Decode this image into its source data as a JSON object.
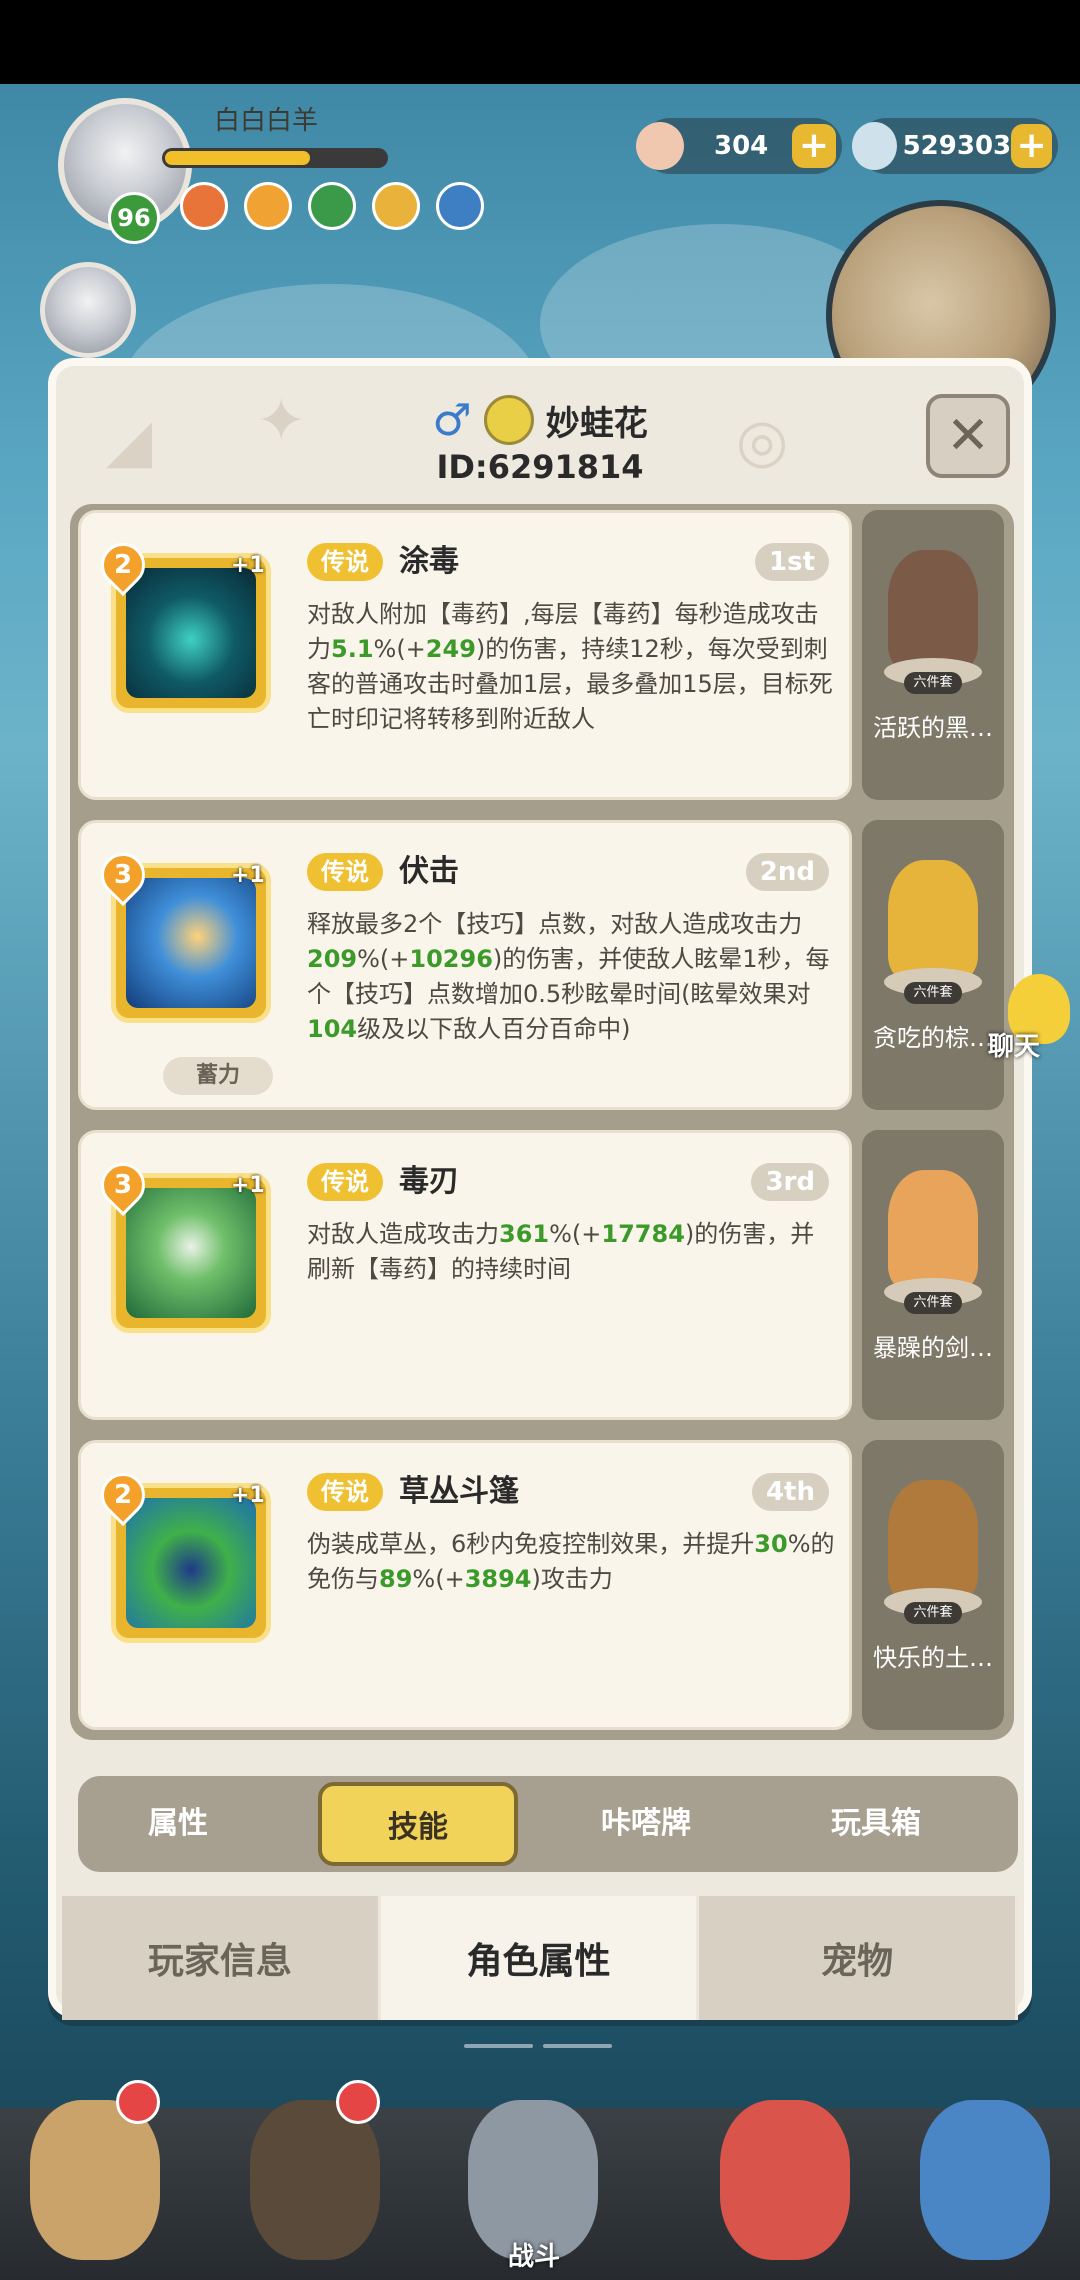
{
  "hud": {
    "player_name": "白白白羊",
    "level": "96",
    "hp_fraction": 0.66,
    "currency_1": "304",
    "currency_2": "529303"
  },
  "dialog": {
    "character_name": "妙蛙花",
    "character_id": "ID:6291814",
    "close_icon": "close-icon",
    "gender_icon": "male-icon"
  },
  "skills": [
    {
      "level": "2",
      "plus": "+1",
      "rarity": "传说",
      "name": "涂毒",
      "rank": "1st",
      "desc_parts": [
        "对敌人附加【毒药】,每层【毒药】每秒造成攻击力",
        "5.1",
        "%(+",
        "249",
        ")的伤害，持续12秒，每次受到刺客的普通攻击时叠加1层，最多叠加15层，目标死亡时印记将转移到附近敌人"
      ],
      "pet_name": "活跃的黑…",
      "set_tag": "六件套"
    },
    {
      "level": "3",
      "plus": "+1",
      "rarity": "传说",
      "name": "伏击",
      "rank": "2nd",
      "desc_parts": [
        "释放最多2个【技巧】点数，对敌人造成攻击力",
        "209",
        "%(+",
        "10296",
        ")的伤害，并使敌人眩晕1秒，每个【技巧】点数增加0.5秒眩晕时间(眩晕效果对",
        "104",
        "级及以下敌人百分百命中)"
      ],
      "charge_tag": "蓄力",
      "pet_name": "贪吃的棕…",
      "set_tag": "六件套"
    },
    {
      "level": "3",
      "plus": "+1",
      "rarity": "传说",
      "name": "毒刃",
      "rank": "3rd",
      "desc_parts": [
        "对敌人造成攻击力",
        "361",
        "%(+",
        "17784",
        ")的伤害，并刷新【毒药】的持续时间"
      ],
      "pet_name": "暴躁的剑…",
      "set_tag": "六件套"
    },
    {
      "level": "2",
      "plus": "+1",
      "rarity": "传说",
      "name": "草丛斗篷",
      "rank": "4th",
      "desc_parts": [
        "伪装成草丛，6秒内免疫控制效果，并提升",
        "30",
        "%的免伤与",
        "89",
        "%(+",
        "3894",
        ")攻击力"
      ],
      "pet_name": "快乐的土…",
      "set_tag": "六件套"
    }
  ],
  "sub_tabs": [
    "属性",
    "技能",
    "咔嗒牌",
    "玩具箱"
  ],
  "main_tabs": [
    "玩家信息",
    "角色属性",
    "宠物"
  ],
  "chat": {
    "label": "聊天"
  },
  "bottom_nav": {
    "battle_label": "战斗"
  },
  "colors": {
    "highlight_green": "#3b9a2a",
    "legend_gold": "#efc132",
    "active_tab": "#f2d35a"
  }
}
